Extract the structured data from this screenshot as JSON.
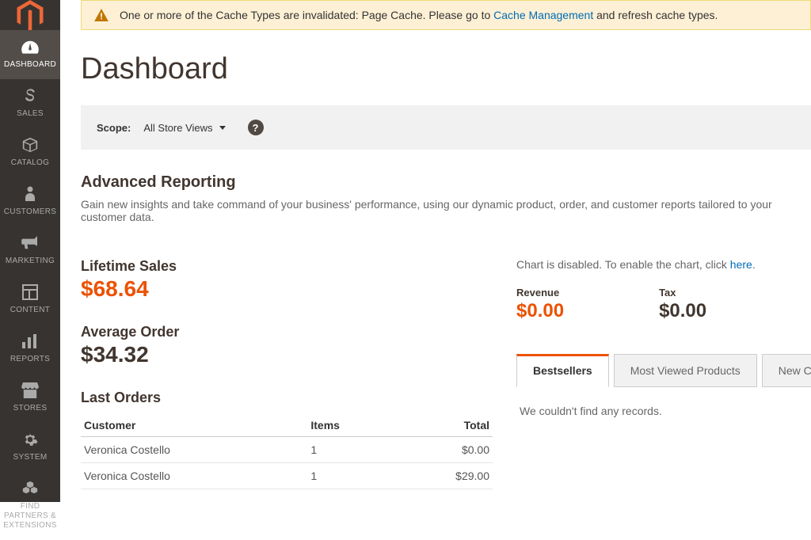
{
  "sidebar": {
    "items": [
      {
        "label": "DASHBOARD"
      },
      {
        "label": "SALES"
      },
      {
        "label": "CATALOG"
      },
      {
        "label": "CUSTOMERS"
      },
      {
        "label": "MARKETING"
      },
      {
        "label": "CONTENT"
      },
      {
        "label": "REPORTS"
      },
      {
        "label": "STORES"
      },
      {
        "label": "SYSTEM"
      },
      {
        "label": "FIND PARTNERS & EXTENSIONS"
      }
    ]
  },
  "notice": {
    "prefix": "One or more of the Cache Types are invalidated: Page Cache. Please go to ",
    "link": "Cache Management",
    "suffix": " and refresh cache types."
  },
  "page_title": "Dashboard",
  "scope": {
    "label": "Scope:",
    "value": "All Store Views"
  },
  "advanced": {
    "title": "Advanced Reporting",
    "desc": "Gain new insights and take command of your business' performance, using our dynamic product, order, and customer reports tailored to your customer data."
  },
  "metrics": {
    "lifetime_label": "Lifetime Sales",
    "lifetime_value": "$68.64",
    "avg_label": "Average Order",
    "avg_value": "$34.32"
  },
  "last_orders": {
    "title": "Last Orders",
    "cols": {
      "customer": "Customer",
      "items": "Items",
      "total": "Total"
    },
    "rows": [
      {
        "customer": "Veronica Costello",
        "items": "1",
        "total": "$0.00"
      },
      {
        "customer": "Veronica Costello",
        "items": "1",
        "total": "$29.00"
      }
    ]
  },
  "chart": {
    "disabled_prefix": "Chart is disabled. To enable the chart, click ",
    "disabled_link": "here",
    "disabled_suffix": "."
  },
  "stats": {
    "revenue_label": "Revenue",
    "revenue_value": "$0.00",
    "tax_label": "Tax",
    "tax_value": "$0.00"
  },
  "tabs": {
    "items": [
      "Bestsellers",
      "Most Viewed Products",
      "New Custome"
    ],
    "content": "We couldn't find any records."
  }
}
